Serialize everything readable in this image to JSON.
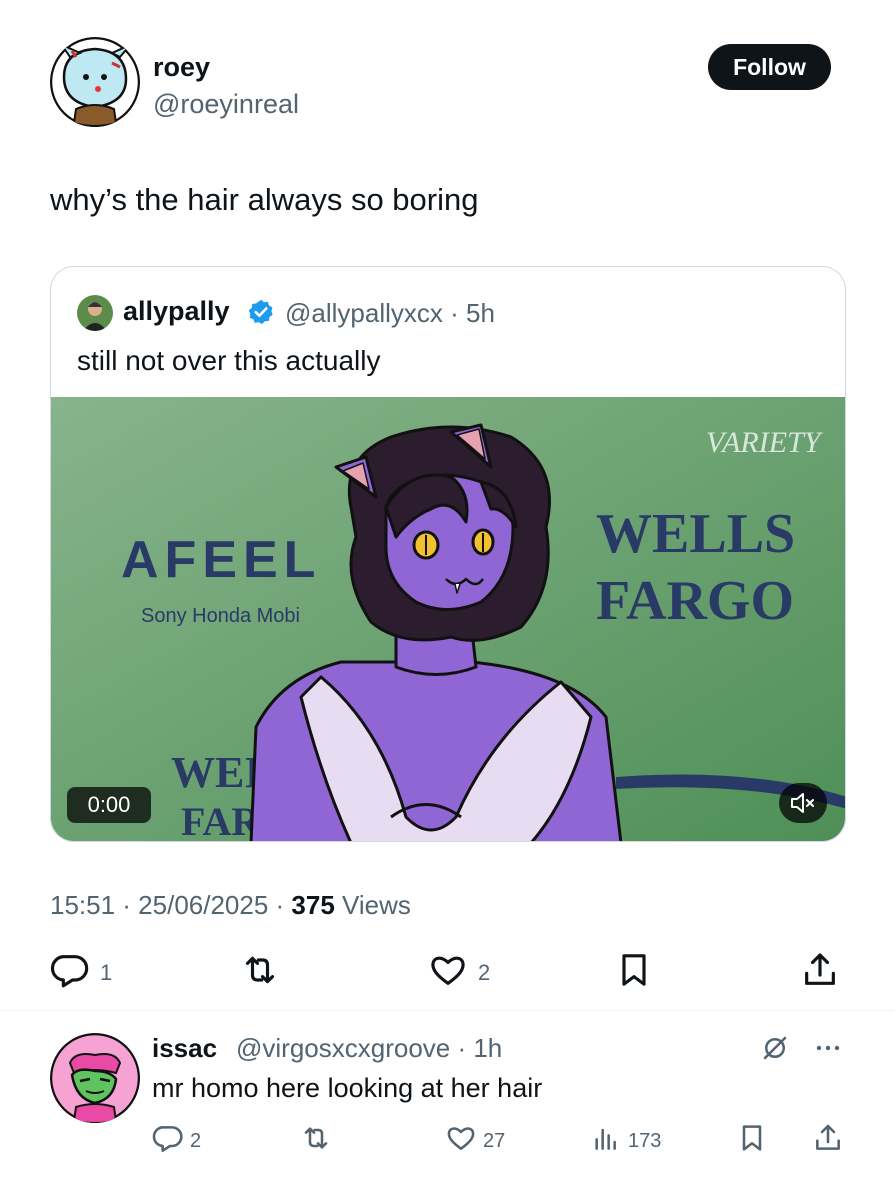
{
  "post": {
    "display_name": "roey",
    "handle": "@roeyinreal",
    "follow_label": "Follow",
    "text": "why’s the hair always so boring",
    "timestamp": "15:51 · 25/06/2025 · ",
    "views_count": "375",
    "views_label": " Views",
    "actions": {
      "replies": "1",
      "likes": "2"
    }
  },
  "quote": {
    "display_name": "allypally",
    "meta": "@allypallyxcx · 5h",
    "text": "still not over this actually",
    "media": {
      "backdrop_brand_1": "AFEEL",
      "backdrop_brand_1_sub": "Sony Honda Mobi",
      "backdrop_brand_2_line1": "WELLS",
      "backdrop_brand_2_line2": "FARGO",
      "backdrop_watermark": "VARIETY",
      "backdrop_lower_1": "WEI",
      "backdrop_lower_2": "FAR",
      "video_time": "0:00"
    }
  },
  "reply": {
    "display_name": "issac",
    "meta": "@virgosxcxgroove · 1h",
    "text": "mr homo here looking at her hair",
    "actions": {
      "replies": "2",
      "likes": "27",
      "views": "173"
    }
  },
  "icons": {
    "reply": "reply-icon",
    "repost": "repost-icon",
    "like": "heart-icon",
    "bookmark": "bookmark-icon",
    "share": "share-icon",
    "views": "views-icon",
    "verified": "verified-badge-icon",
    "mute": "mute-icon",
    "more": "more-icon",
    "grok": "grok-icon"
  },
  "colors": {
    "text_primary": "#0f1419",
    "text_secondary": "#536471",
    "verified_blue": "#1d9bf0",
    "backdrop_green": "#6f9f72",
    "brand_navy": "#2a3a66"
  }
}
